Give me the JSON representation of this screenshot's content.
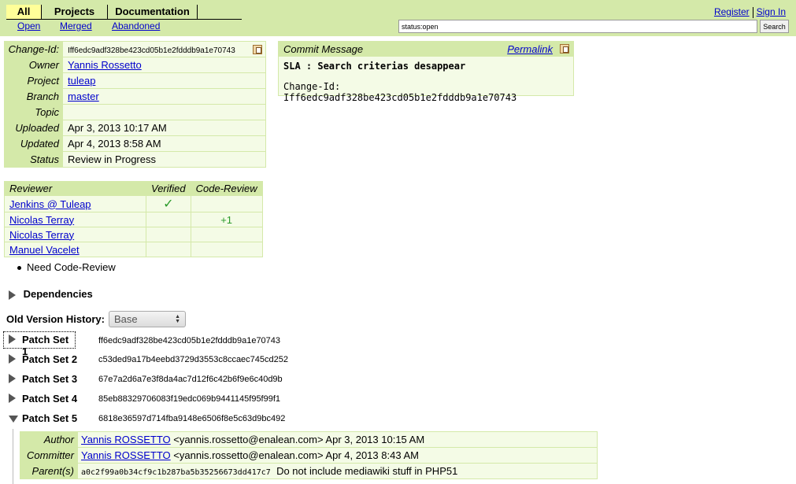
{
  "header": {
    "tabs": [
      {
        "label": "All"
      },
      {
        "label": "Projects"
      },
      {
        "label": "Documentation"
      }
    ],
    "subtabs": [
      {
        "label": "Open"
      },
      {
        "label": "Merged"
      },
      {
        "label": "Abandoned"
      }
    ],
    "register_label": "Register",
    "signin_label": "Sign In",
    "search_value": "status:open",
    "search_button_label": "Search"
  },
  "info": {
    "rows": [
      {
        "label": "Change-Id:",
        "value": "Iff6edc9adf328be423cd05b1e2fdddb9a1e70743"
      },
      {
        "label": "Owner",
        "value": "Yannis Rossetto"
      },
      {
        "label": "Project",
        "value": "tuleap"
      },
      {
        "label": "Branch",
        "value": "master"
      },
      {
        "label": "Topic",
        "value": ""
      },
      {
        "label": "Uploaded",
        "value": "Apr 3, 2013 10:17 AM"
      },
      {
        "label": "Updated",
        "value": "Apr 4, 2013 8:58 AM"
      },
      {
        "label": "Status",
        "value": "Review in Progress"
      }
    ]
  },
  "commit": {
    "title": "Commit Message",
    "permalink_label": "Permalink",
    "subject": "SLA : Search criterias desappear",
    "change_id": "Change-Id: Iff6edc9adf328be423cd05b1e2fdddb9a1e70743"
  },
  "reviewers": {
    "headers": {
      "reviewer": "Reviewer",
      "verified": "Verified",
      "code_review": "Code-Review"
    },
    "rows": [
      {
        "name": "Jenkins @ Tuleap",
        "verified": "✓",
        "code_review": ""
      },
      {
        "name": "Nicolas Terray",
        "verified": "",
        "code_review": "+1"
      },
      {
        "name": "Nicolas Terray",
        "verified": "",
        "code_review": ""
      },
      {
        "name": "Manuel Vacelet",
        "verified": "",
        "code_review": ""
      }
    ],
    "need": "Need Code-Review"
  },
  "dependencies_label": "Dependencies",
  "old_history": {
    "label": "Old Version History:",
    "selected": "Base"
  },
  "patch_sets": [
    {
      "label": "Patch Set 1",
      "hash": "ff6edc9adf328be423cd05b1e2fdddb9a1e70743"
    },
    {
      "label": "Patch Set 2",
      "hash": "c53ded9a17b4eebd3729d3553c8ccaec745cd252"
    },
    {
      "label": "Patch Set 3",
      "hash": "67e7a2d6a7e3f8da4ac7d12f6c42b6f9e6c40d9b"
    },
    {
      "label": "Patch Set 4",
      "hash": "85eb88329706083f19edc069b9441145f95f99f1"
    },
    {
      "label": "Patch Set 5",
      "hash": "6818e36597d714fba9148e6506f8e5c63d9bc492"
    }
  ],
  "ps5": {
    "author_label": "Author",
    "author_name": "Yannis ROSSETTO",
    "author_rest": " <yannis.rossetto@enalean.com> Apr 3, 2013 10:15 AM",
    "committer_label": "Committer",
    "committer_name": "Yannis ROSSETTO",
    "committer_rest": " <yannis.rossetto@enalean.com> Apr 4, 2013 8:43 AM",
    "parents_label": "Parent(s)",
    "parent_hash": "a0c2f99a0b34cf9c1b287ba5b35256673dd417c7",
    "parent_msg": "Do not include mediawiki stuff in PHP51"
  },
  "colors": {
    "header_bg": "#d4e9a9",
    "panel_bg": "#f4fbe6",
    "link": "#0000cc",
    "approved": "#2a9a2a"
  }
}
